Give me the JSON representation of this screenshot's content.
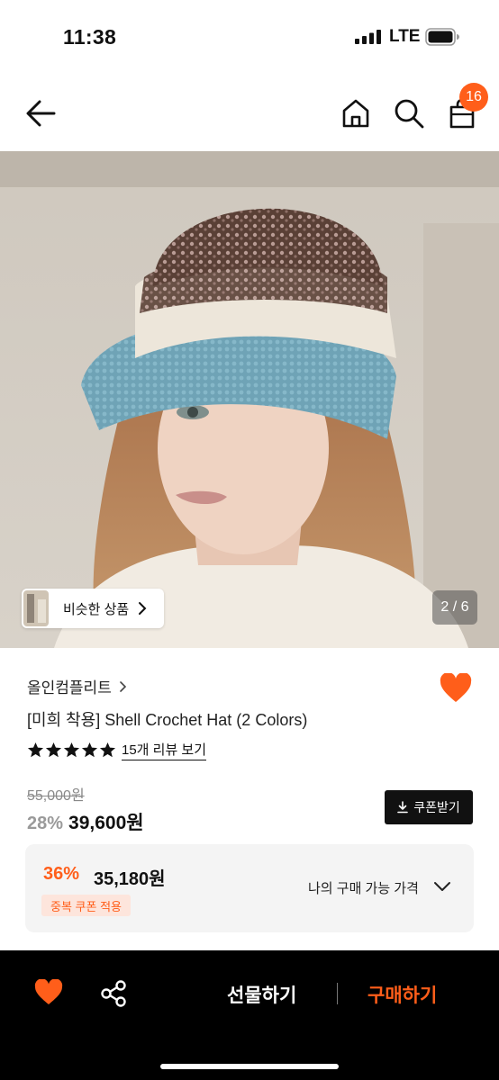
{
  "status": {
    "time": "11:38",
    "network": "LTE",
    "icons": [
      "signal-icon",
      "battery-icon"
    ]
  },
  "nav": {
    "icons": [
      "back-arrow-icon",
      "home-icon",
      "search-icon",
      "shopping-bag-icon"
    ],
    "cart_count": "16"
  },
  "gallery": {
    "similar_label": "비슷한 상품",
    "page_indicator": "2 / 6"
  },
  "product": {
    "brand": "올인컴플리트",
    "title": "[미희 착용] Shell Crochet Hat (2 Colors)",
    "rating": 5,
    "review_link": "15개 리뷰 보기",
    "liked": true,
    "original_price": "55,000원",
    "discount_rate": "28%",
    "price": "39,600원",
    "coupon_button": "쿠폰받기"
  },
  "my_price": {
    "discount_rate": "36%",
    "price": "35,180원",
    "badge": "중복 쿠폰 적용",
    "label": "나의 구매 가능 가격"
  },
  "bottom_bar": {
    "gift_label": "선물하기",
    "buy_label": "구매하기"
  },
  "colors": {
    "accent": "#ff5e1a",
    "bottom_bar": "#000000",
    "box_bg": "#f4f4f4"
  }
}
